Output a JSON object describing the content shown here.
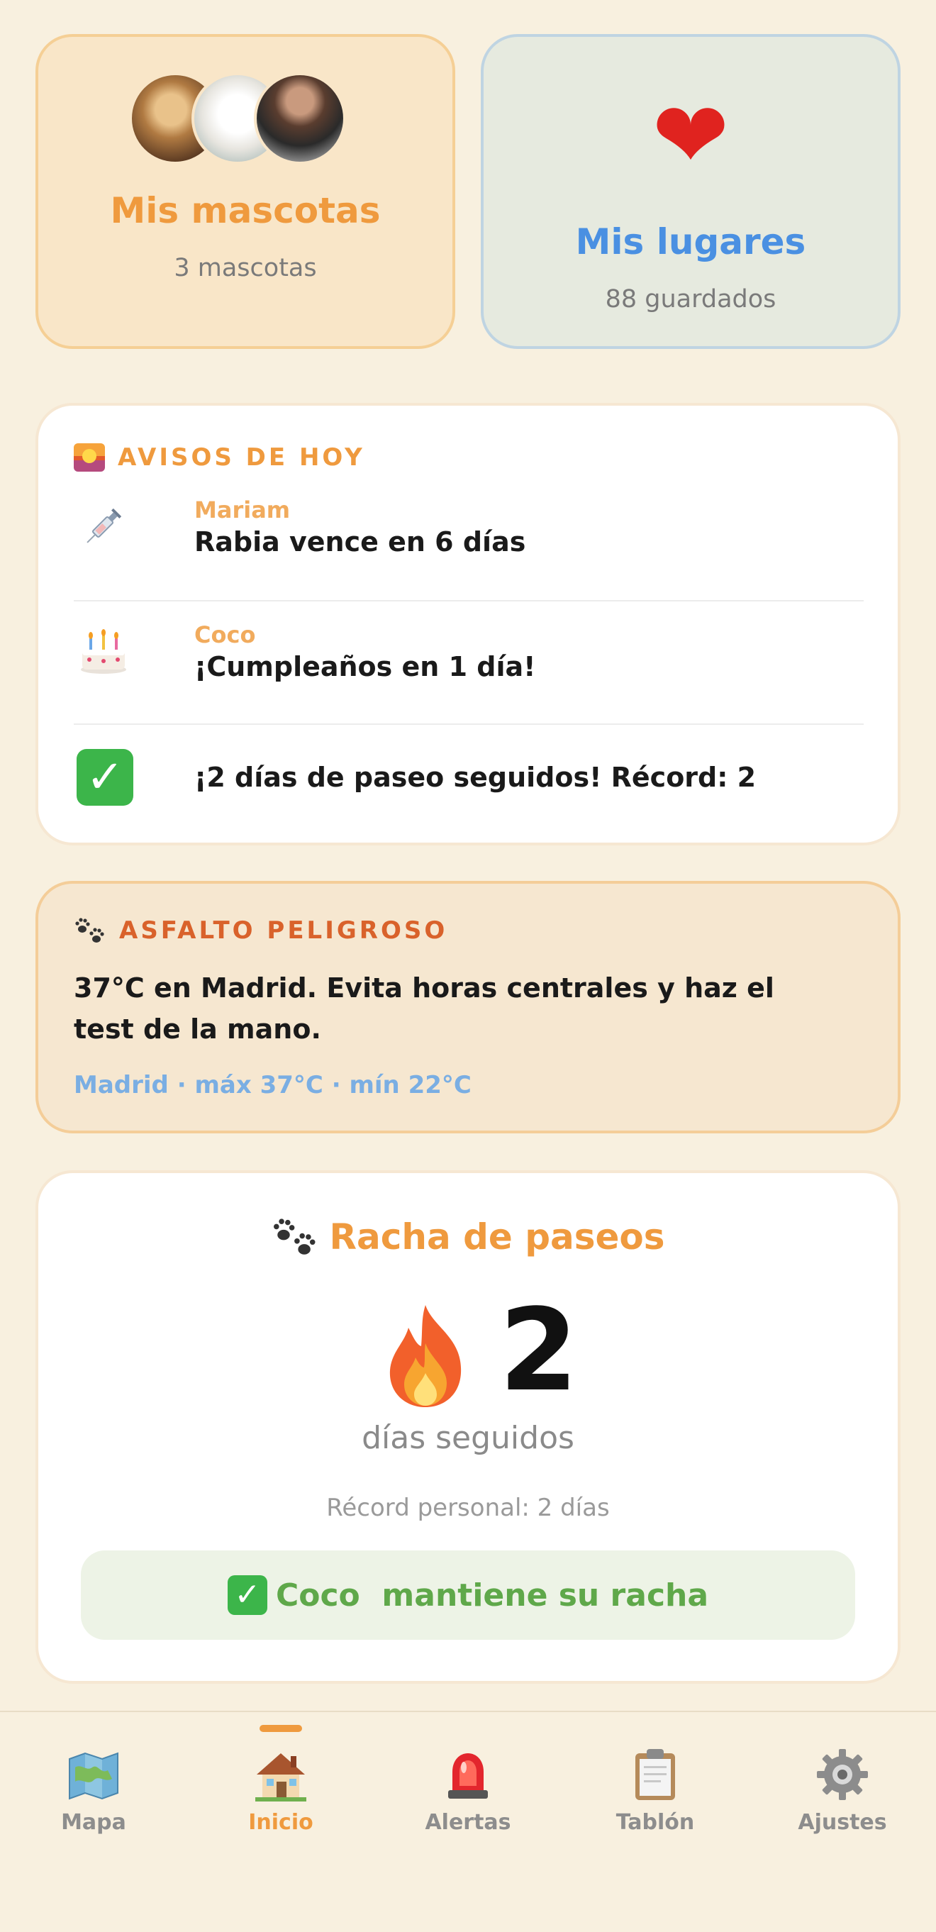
{
  "pets_card": {
    "title": "Mis mascotas",
    "subtitle": "3 mascotas",
    "accent": "#ef9a3e"
  },
  "places_card": {
    "title": "Mis lugares",
    "subtitle": "88 guardados",
    "icon": "heart-icon",
    "accent": "#4a90e2"
  },
  "avisos": {
    "header": "AVISOS DE HOY",
    "items": [
      {
        "name": "Mariam",
        "text": "Rabia vence en 6 días",
        "icon": "syringe-icon"
      },
      {
        "name": "Coco",
        "text": "¡Cumpleaños en 1 día!",
        "icon": "birthday-cake-icon"
      },
      {
        "name": "",
        "text": "¡2 días de paseo seguidos! Récord: 2",
        "icon": "check-mark-icon"
      }
    ]
  },
  "asfalto": {
    "header": "ASFALTO PELIGROSO",
    "text": "37°C en Madrid. Evita horas centrales y haz el test de la mano.",
    "meta": "Madrid · máx 37°C · mín 22°C",
    "accent": "#d9622b"
  },
  "racha": {
    "title": "Racha de paseos",
    "count": "2",
    "days_label": "días seguidos",
    "record": "Récord personal: 2 días",
    "badge": "Coco  mantiene su racha",
    "badge_color": "#5fa84a"
  },
  "tabbar": {
    "active": "Inicio",
    "tabs": [
      {
        "label": "Mapa",
        "icon": "map-icon"
      },
      {
        "label": "Inicio",
        "icon": "house-icon"
      },
      {
        "label": "Alertas",
        "icon": "siren-icon"
      },
      {
        "label": "Tablón",
        "icon": "clipboard-icon"
      },
      {
        "label": "Ajustes",
        "icon": "gear-icon"
      }
    ]
  }
}
